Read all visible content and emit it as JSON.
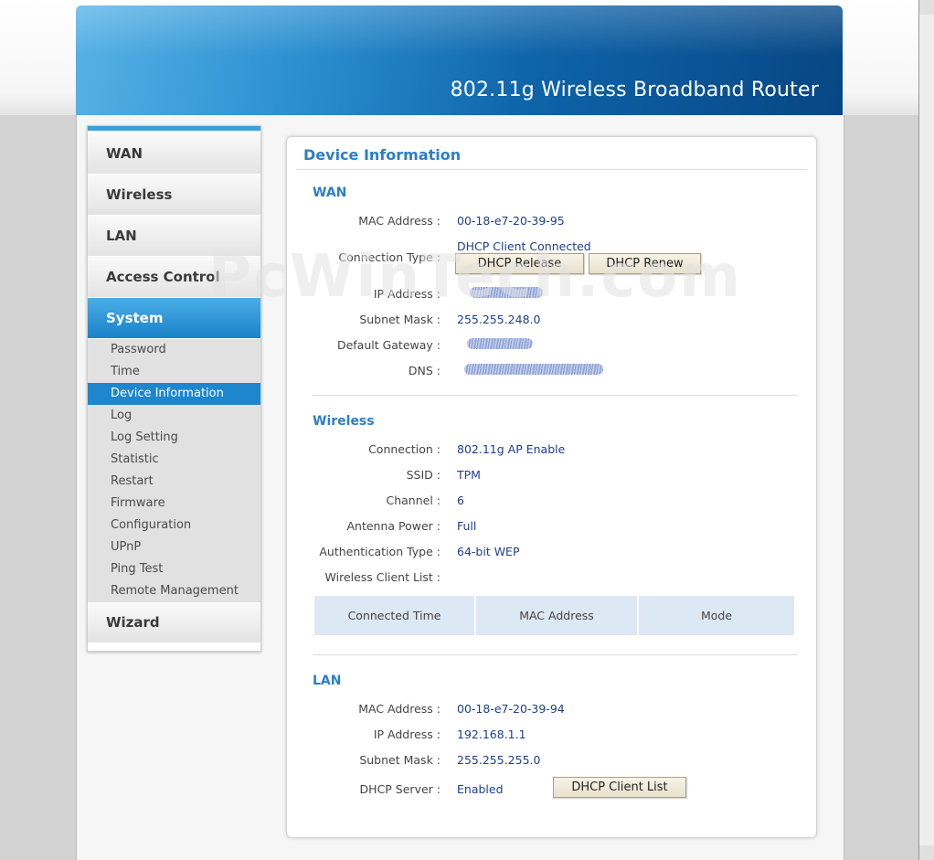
{
  "header": {
    "title": "802.11g Wireless Broadband Router"
  },
  "watermark": "PcWinTech.com",
  "sidebar": {
    "main_items": [
      "WAN",
      "Wireless",
      "LAN",
      "Access Control",
      "System",
      "Wizard"
    ],
    "active_main": "System",
    "sub_items": [
      "Password",
      "Time",
      "Device Information",
      "Log",
      "Log Setting",
      "Statistic",
      "Restart",
      "Firmware",
      "Configuration",
      "UPnP",
      "Ping Test",
      "Remote Management"
    ],
    "active_sub": "Device Information"
  },
  "panel": {
    "title": "Device Information",
    "wan": {
      "title": "WAN",
      "mac_label": "MAC Address :",
      "mac": "00-18-e7-20-39-95",
      "conn_label": "Connection Type :",
      "conn": "DHCP Client Connected",
      "release_button": "DHCP Release",
      "renew_button": "DHCP Renew",
      "ip_label": "IP Address :",
      "mask_label": "Subnet Mask :",
      "mask": "255.255.248.0",
      "gateway_label": "Default Gateway :",
      "dns_label": "DNS :"
    },
    "wireless": {
      "title": "Wireless",
      "conn_label": "Connection :",
      "conn": "802.11g AP Enable",
      "ssid_label": "SSID :",
      "ssid": "TPM",
      "channel_label": "Channel :",
      "channel": "6",
      "power_label": "Antenna Power :",
      "power": "Full",
      "auth_label": "Authentication Type :",
      "auth": "64-bit WEP",
      "client_list_label": "Wireless Client List :",
      "table_headers": [
        "Connected Time",
        "MAC Address",
        "Mode"
      ]
    },
    "lan": {
      "title": "LAN",
      "mac_label": "MAC Address :",
      "mac": "00-18-e7-20-39-94",
      "ip_label": "IP Address :",
      "ip": "192.168.1.1",
      "mask_label": "Subnet Mask :",
      "mask": "255.255.255.0",
      "dhcp_label": "DHCP Server :",
      "dhcp": "Enabled",
      "client_list_button": "DHCP Client List"
    }
  }
}
